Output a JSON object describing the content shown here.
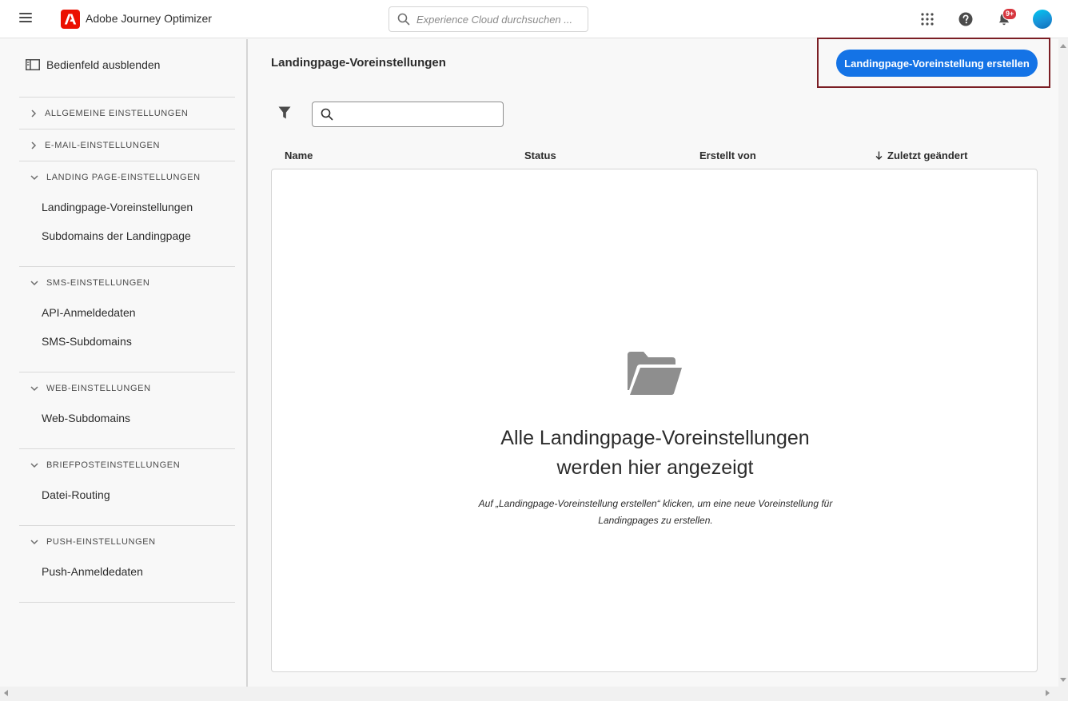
{
  "header": {
    "app_title": "Adobe Journey Optimizer",
    "search_placeholder": "Experience Cloud durchsuchen ...",
    "notification_count": "9+",
    "icons": [
      "menu-icon",
      "adobe-logo",
      "search-icon",
      "apps-grid-icon",
      "help-icon",
      "bell-icon",
      "avatar"
    ]
  },
  "sidebar": {
    "collapse_label": "Bedienfeld ausblenden",
    "sections": [
      {
        "label": "ALLGEMEINE EINSTELLUNGEN",
        "expanded": false,
        "items": []
      },
      {
        "label": "E-MAIL-EINSTELLUNGEN",
        "expanded": false,
        "items": []
      },
      {
        "label": "LANDING PAGE-EINSTELLUNGEN",
        "expanded": true,
        "items": [
          "Landingpage-Voreinstellungen",
          "Subdomains der Landingpage"
        ]
      },
      {
        "label": "SMS-EINSTELLUNGEN",
        "expanded": true,
        "items": [
          "API-Anmeldedaten",
          "SMS-Subdomains"
        ]
      },
      {
        "label": "WEB-EINSTELLUNGEN",
        "expanded": true,
        "items": [
          "Web-Subdomains"
        ]
      },
      {
        "label": "BRIEFPOSTEINSTELLUNGEN",
        "expanded": true,
        "items": [
          "Datei-Routing"
        ]
      },
      {
        "label": "PUSH-EINSTELLUNGEN",
        "expanded": true,
        "items": [
          "Push-Anmeldedaten"
        ]
      }
    ]
  },
  "main": {
    "title": "Landingpage-Voreinstellungen",
    "create_button": "Landingpage-Voreinstellung erstellen",
    "search_placeholder": "",
    "columns": [
      "Name",
      "Status",
      "Erstellt von",
      "Zuletzt geändert"
    ],
    "sort_column": "Zuletzt geändert",
    "empty_title_line1": "Alle Landingpage-Voreinstellungen",
    "empty_title_line2": "werden hier angezeigt",
    "empty_desc_line1": "Auf „Landingpage-Voreinstellung erstellen“ klicken, um eine neue Voreinstellung für",
    "empty_desc_line2": "Landingpages zu erstellen."
  },
  "colors": {
    "primary_button": "#1473e6",
    "adobe_red": "#eb1000",
    "highlight_frame": "#7b1e24",
    "badge": "#d7373f"
  }
}
